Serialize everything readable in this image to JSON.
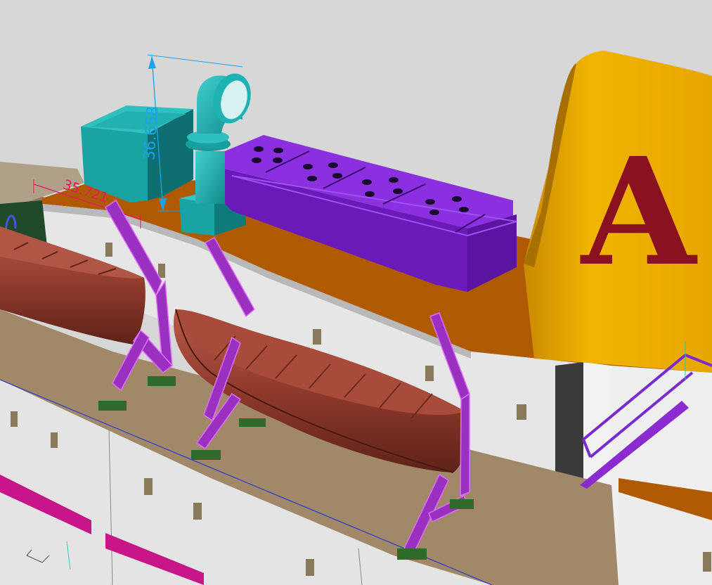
{
  "viewport": {
    "title": "",
    "background_color": "#d7d7d7"
  },
  "dimensions": {
    "vertical_value": "36.658",
    "horizontal_value": "35.721",
    "vertical_color": "#1aa3e8",
    "horizontal_color": "#e8175d"
  },
  "funnel": {
    "letter": "A",
    "body_color": "#e8a800",
    "letter_color": "#8a1220"
  },
  "colors": {
    "deck": "#b05a00",
    "hull_white": "#e8e8e8",
    "deck_floor": "#a08868",
    "teal": "#1aa3a3",
    "purple_vent": "#7a22c8",
    "lifeboat": "#9a4232",
    "davit": "#8a2ab0",
    "green_base": "#2f6a2a",
    "magenta_rail": "#c8158a"
  }
}
